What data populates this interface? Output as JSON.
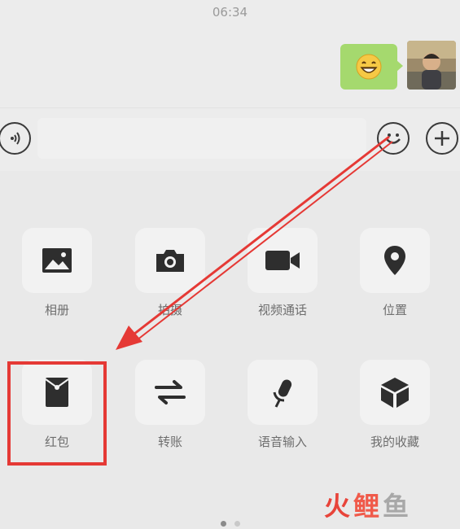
{
  "status_bar": {
    "time": "06:34"
  },
  "chat": {
    "sent_message": {
      "emoji_icon": "grinning-face-icon"
    },
    "avatar": {
      "icon": "user-avatar"
    }
  },
  "input_bar": {
    "voice_icon": "voice-icon",
    "emoji_icon": "smiley-icon",
    "plus_icon": "plus-icon"
  },
  "panel": {
    "items": [
      {
        "label": "相册",
        "icon": "image-icon"
      },
      {
        "label": "拍摄",
        "icon": "camera-icon"
      },
      {
        "label": "视频通话",
        "icon": "video-call-icon"
      },
      {
        "label": "位置",
        "icon": "location-pin-icon"
      },
      {
        "label": "红包",
        "icon": "red-envelope-icon"
      },
      {
        "label": "转账",
        "icon": "transfer-icon"
      },
      {
        "label": "语音输入",
        "icon": "microphone-icon"
      },
      {
        "label": "我的收藏",
        "icon": "favorites-cube-icon"
      }
    ],
    "page_indicator": {
      "pages": 2,
      "current": 1
    }
  },
  "annotation": {
    "highlight_color": "#e53935",
    "arrow_color": "#e53935"
  },
  "watermark": {
    "text_1": "火",
    "text_2": "鲤",
    "text_3": "鱼"
  }
}
